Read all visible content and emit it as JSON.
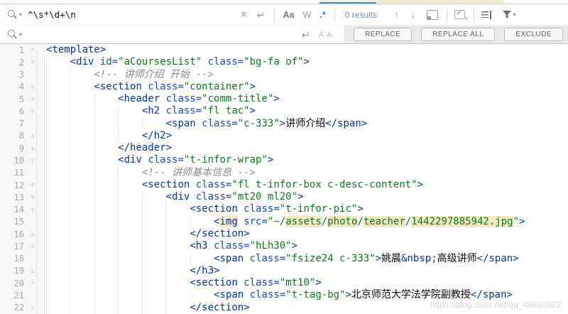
{
  "find_bar": {
    "search_query": "^\\s*\\d+\\n",
    "replace_value": "",
    "caret_icon": "▾",
    "close_label": "×",
    "newline_icon": "↵",
    "match_case_label": "Aa",
    "words_label": "W",
    "regex_label": ".*",
    "regex_active": true,
    "results_text": "0 results",
    "up_label": "↑",
    "down_label": "↓",
    "preserve_case_label": "A′A",
    "replace_button": "REPLACE",
    "replace_all_button": "REPLACE ALL",
    "exclude_button": "EXCLUDE"
  },
  "editor": {
    "colors": {
      "tag": "#0033b3",
      "attr": "#174ad4",
      "string": "#067d17",
      "text": "#080808",
      "comment": "#8c8c8c",
      "entity": "#0033b3",
      "highlight": "#f2e9c3"
    },
    "fold_open_icon": "▿",
    "fold_close_icon": "▵",
    "watermark": "https://blog.csdn.net/qq_40910622",
    "lines": [
      {
        "n": 1,
        "indent": 0,
        "fold": "open",
        "tokens": [
          {
            "c": "tag",
            "t": "<template>"
          }
        ]
      },
      {
        "n": 2,
        "indent": 4,
        "fold": "open",
        "tokens": [
          {
            "c": "tag",
            "t": "<div "
          },
          {
            "c": "attr",
            "t": "id="
          },
          {
            "c": "str",
            "t": "\"aCoursesList\""
          },
          {
            "c": "attr",
            "t": " class="
          },
          {
            "c": "str",
            "t": "\"bg-fa of\""
          },
          {
            "c": "tag",
            "t": ">"
          }
        ]
      },
      {
        "n": 3,
        "indent": 8,
        "fold": null,
        "tokens": [
          {
            "c": "cmt",
            "t": "<!-- 讲师介绍 开始 -->"
          }
        ]
      },
      {
        "n": 4,
        "indent": 8,
        "fold": "open",
        "tokens": [
          {
            "c": "tag",
            "t": "<section "
          },
          {
            "c": "attr",
            "t": "class="
          },
          {
            "c": "str",
            "t": "\"container\""
          },
          {
            "c": "tag",
            "t": ">"
          }
        ]
      },
      {
        "n": 5,
        "indent": 12,
        "fold": "open",
        "tokens": [
          {
            "c": "tag",
            "t": "<header "
          },
          {
            "c": "attr",
            "t": "class="
          },
          {
            "c": "str",
            "t": "\"comm-title\""
          },
          {
            "c": "tag",
            "t": ">"
          }
        ]
      },
      {
        "n": 6,
        "indent": 16,
        "fold": "open",
        "tokens": [
          {
            "c": "tag",
            "t": "<h2 "
          },
          {
            "c": "attr",
            "t": "class="
          },
          {
            "c": "str",
            "t": "\"fl tac\""
          },
          {
            "c": "tag",
            "t": ">"
          }
        ]
      },
      {
        "n": 7,
        "indent": 20,
        "fold": null,
        "tokens": [
          {
            "c": "tag",
            "t": "<span "
          },
          {
            "c": "attr",
            "t": "class="
          },
          {
            "c": "str",
            "t": "\"c-333\""
          },
          {
            "c": "tag",
            "t": ">"
          },
          {
            "c": "txt",
            "t": "讲师介绍"
          },
          {
            "c": "tag",
            "t": "</span>"
          }
        ]
      },
      {
        "n": 8,
        "indent": 16,
        "fold": "close",
        "tokens": [
          {
            "c": "tag",
            "t": "</h2>"
          }
        ]
      },
      {
        "n": 9,
        "indent": 12,
        "fold": "close",
        "tokens": [
          {
            "c": "tag",
            "t": "</header>"
          }
        ]
      },
      {
        "n": 10,
        "indent": 12,
        "fold": "open",
        "tokens": [
          {
            "c": "tag",
            "t": "<div "
          },
          {
            "c": "attr",
            "t": "class="
          },
          {
            "c": "str",
            "t": "\"t-infor-wrap\""
          },
          {
            "c": "tag",
            "t": ">"
          }
        ]
      },
      {
        "n": 11,
        "indent": 16,
        "fold": null,
        "tokens": [
          {
            "c": "cmt",
            "t": "<!-- 讲师基本信息 -->"
          }
        ]
      },
      {
        "n": 12,
        "indent": 16,
        "fold": "open",
        "tokens": [
          {
            "c": "tag",
            "t": "<section "
          },
          {
            "c": "attr",
            "t": "class="
          },
          {
            "c": "str",
            "t": "\"fl t-infor-box c-desc-content\""
          },
          {
            "c": "tag",
            "t": ">"
          }
        ]
      },
      {
        "n": 13,
        "indent": 20,
        "fold": "open",
        "tokens": [
          {
            "c": "tag",
            "t": "<div "
          },
          {
            "c": "attr",
            "t": "class="
          },
          {
            "c": "str",
            "t": "\"mt20 ml20\""
          },
          {
            "c": "tag",
            "t": ">"
          }
        ]
      },
      {
        "n": 14,
        "indent": 24,
        "fold": "open",
        "tokens": [
          {
            "c": "tag",
            "t": "<section "
          },
          {
            "c": "attr",
            "t": "class="
          },
          {
            "c": "str",
            "t": "\"t-infor-pic\""
          },
          {
            "c": "tag",
            "t": ">"
          }
        ]
      },
      {
        "n": 15,
        "indent": 28,
        "fold": null,
        "tokens": [
          {
            "c": "tag",
            "t": "<"
          },
          {
            "c": "tag",
            "t": "img",
            "h": true
          },
          {
            "c": "attr",
            "t": " src="
          },
          {
            "c": "str",
            "t": "\"~/"
          },
          {
            "c": "str",
            "t": "assets",
            "h": true
          },
          {
            "c": "str",
            "t": "/"
          },
          {
            "c": "str",
            "t": "photo",
            "h": true
          },
          {
            "c": "str",
            "t": "/"
          },
          {
            "c": "str",
            "t": "teacher",
            "h": true
          },
          {
            "c": "str",
            "t": "/"
          },
          {
            "c": "str",
            "t": "1442297885942.jpg",
            "h": true
          },
          {
            "c": "str",
            "t": "\""
          },
          {
            "c": "tag",
            "t": ">"
          }
        ]
      },
      {
        "n": 16,
        "indent": 24,
        "fold": "close",
        "tokens": [
          {
            "c": "tag",
            "t": "</section>"
          }
        ]
      },
      {
        "n": 17,
        "indent": 24,
        "fold": "open",
        "tokens": [
          {
            "c": "tag",
            "t": "<h3 "
          },
          {
            "c": "attr",
            "t": "class="
          },
          {
            "c": "str",
            "t": "\"hLh30\""
          },
          {
            "c": "tag",
            "t": ">"
          }
        ]
      },
      {
        "n": 18,
        "indent": 28,
        "fold": null,
        "tokens": [
          {
            "c": "tag",
            "t": "<span "
          },
          {
            "c": "attr",
            "t": "class="
          },
          {
            "c": "str",
            "t": "\"fsize24 c-333\""
          },
          {
            "c": "tag",
            "t": ">"
          },
          {
            "c": "txt",
            "t": "姚晨"
          },
          {
            "c": "ent",
            "t": "&nbsp;"
          },
          {
            "c": "txt",
            "t": "高级讲师"
          },
          {
            "c": "tag",
            "t": "</span>"
          }
        ]
      },
      {
        "n": 19,
        "indent": 24,
        "fold": "close",
        "tokens": [
          {
            "c": "tag",
            "t": "</h3>"
          }
        ]
      },
      {
        "n": 20,
        "indent": 24,
        "fold": "open",
        "tokens": [
          {
            "c": "tag",
            "t": "<section "
          },
          {
            "c": "attr",
            "t": "class="
          },
          {
            "c": "str",
            "t": "\"mt10\""
          },
          {
            "c": "tag",
            "t": ">"
          }
        ]
      },
      {
        "n": 21,
        "indent": 28,
        "fold": null,
        "tokens": [
          {
            "c": "tag",
            "t": "<span "
          },
          {
            "c": "attr",
            "t": "class="
          },
          {
            "c": "str",
            "t": "\"t-tag-bg\""
          },
          {
            "c": "tag",
            "t": ">"
          },
          {
            "c": "txt",
            "t": "北京师范大学法学院副教授"
          },
          {
            "c": "tag",
            "t": "</span>"
          }
        ]
      },
      {
        "n": 22,
        "indent": 24,
        "fold": "close",
        "tokens": [
          {
            "c": "tag",
            "t": "</section>"
          }
        ]
      }
    ]
  }
}
